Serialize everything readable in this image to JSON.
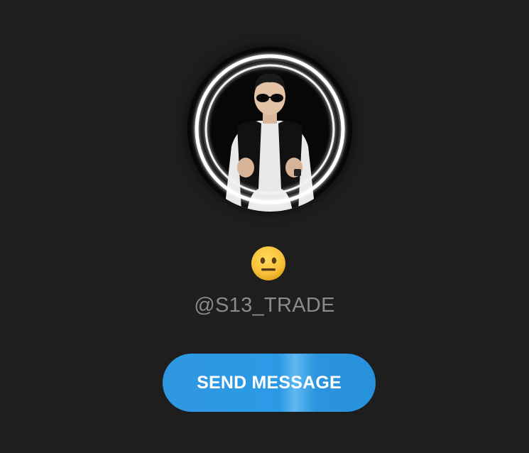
{
  "profile": {
    "status_emoji": "😐",
    "username": "@S13_TRADE"
  },
  "actions": {
    "send_message_label": "SEND MESSAGE"
  },
  "colors": {
    "background": "#1e1e1f",
    "username_text": "#8a8a8c",
    "button": "#2f97e2",
    "button_text": "#ffffff",
    "emoji_face": "#f7c23a"
  }
}
